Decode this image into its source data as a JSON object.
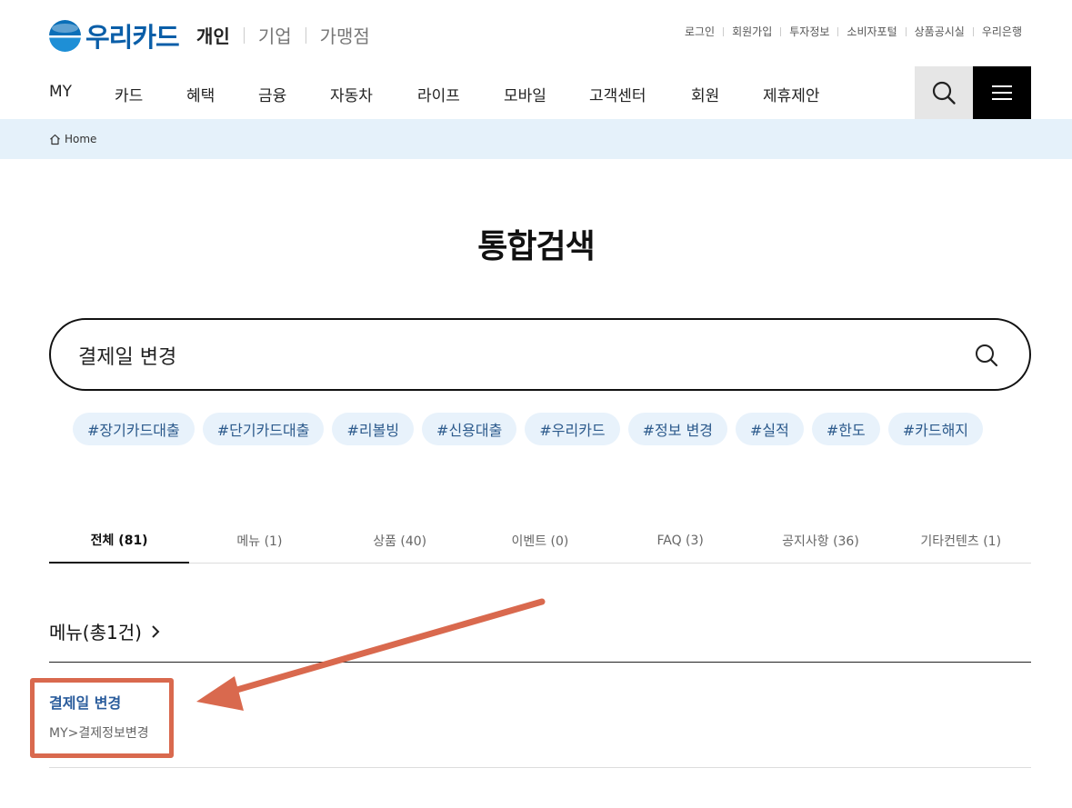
{
  "header": {
    "logo_text": "우리카드",
    "site_switch": [
      "개인",
      "기업",
      "가맹점"
    ],
    "util_links": [
      "로그인",
      "회원가입",
      "투자정보",
      "소비자포털",
      "상품공시실",
      "우리은행"
    ]
  },
  "gnb": {
    "items": [
      "MY",
      "카드",
      "혜택",
      "금융",
      "자동차",
      "라이프",
      "모바일",
      "고객센터",
      "회원",
      "제휴제안"
    ],
    "search_icon": "search-icon",
    "menu_icon": "hamburger-menu-icon"
  },
  "breadcrumb": {
    "icon": "home-icon",
    "label": "Home"
  },
  "page": {
    "title": "통합검색"
  },
  "search": {
    "value": "결제일 변경"
  },
  "tags": [
    "#장기카드대출",
    "#단기카드대출",
    "#리볼빙",
    "#신용대출",
    "#우리카드",
    "#정보 변경",
    "#실적",
    "#한도",
    "#카드해지"
  ],
  "tabs": [
    "전체 (81)",
    "메뉴 (1)",
    "상품 (40)",
    "이벤트 (0)",
    "FAQ (3)",
    "공지사항 (36)",
    "기타컨텐츠 (1)"
  ],
  "section": {
    "heading": "메뉴(총1건)"
  },
  "results": [
    {
      "title": "결제일 변경",
      "path": "MY>결제정보변경"
    }
  ],
  "colors": {
    "brand": "#0a5ea8",
    "breadcrumb_bg": "#e5f1fa",
    "tag_bg": "#e8f2fb",
    "annotation": "#d9694e"
  }
}
